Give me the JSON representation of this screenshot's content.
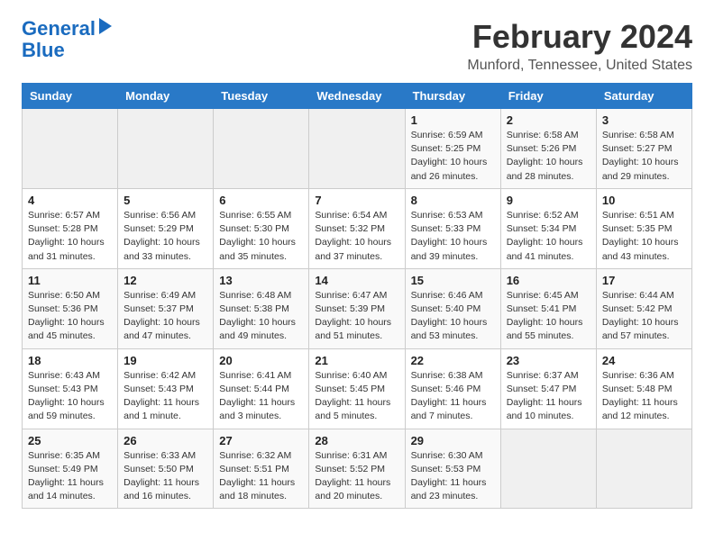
{
  "header": {
    "logo_line1": "General",
    "logo_line2": "Blue",
    "title": "February 2024",
    "subtitle": "Munford, Tennessee, United States"
  },
  "weekdays": [
    "Sunday",
    "Monday",
    "Tuesday",
    "Wednesday",
    "Thursday",
    "Friday",
    "Saturday"
  ],
  "weeks": [
    [
      {
        "day": "",
        "info": ""
      },
      {
        "day": "",
        "info": ""
      },
      {
        "day": "",
        "info": ""
      },
      {
        "day": "",
        "info": ""
      },
      {
        "day": "1",
        "info": "Sunrise: 6:59 AM\nSunset: 5:25 PM\nDaylight: 10 hours\nand 26 minutes."
      },
      {
        "day": "2",
        "info": "Sunrise: 6:58 AM\nSunset: 5:26 PM\nDaylight: 10 hours\nand 28 minutes."
      },
      {
        "day": "3",
        "info": "Sunrise: 6:58 AM\nSunset: 5:27 PM\nDaylight: 10 hours\nand 29 minutes."
      }
    ],
    [
      {
        "day": "4",
        "info": "Sunrise: 6:57 AM\nSunset: 5:28 PM\nDaylight: 10 hours\nand 31 minutes."
      },
      {
        "day": "5",
        "info": "Sunrise: 6:56 AM\nSunset: 5:29 PM\nDaylight: 10 hours\nand 33 minutes."
      },
      {
        "day": "6",
        "info": "Sunrise: 6:55 AM\nSunset: 5:30 PM\nDaylight: 10 hours\nand 35 minutes."
      },
      {
        "day": "7",
        "info": "Sunrise: 6:54 AM\nSunset: 5:32 PM\nDaylight: 10 hours\nand 37 minutes."
      },
      {
        "day": "8",
        "info": "Sunrise: 6:53 AM\nSunset: 5:33 PM\nDaylight: 10 hours\nand 39 minutes."
      },
      {
        "day": "9",
        "info": "Sunrise: 6:52 AM\nSunset: 5:34 PM\nDaylight: 10 hours\nand 41 minutes."
      },
      {
        "day": "10",
        "info": "Sunrise: 6:51 AM\nSunset: 5:35 PM\nDaylight: 10 hours\nand 43 minutes."
      }
    ],
    [
      {
        "day": "11",
        "info": "Sunrise: 6:50 AM\nSunset: 5:36 PM\nDaylight: 10 hours\nand 45 minutes."
      },
      {
        "day": "12",
        "info": "Sunrise: 6:49 AM\nSunset: 5:37 PM\nDaylight: 10 hours\nand 47 minutes."
      },
      {
        "day": "13",
        "info": "Sunrise: 6:48 AM\nSunset: 5:38 PM\nDaylight: 10 hours\nand 49 minutes."
      },
      {
        "day": "14",
        "info": "Sunrise: 6:47 AM\nSunset: 5:39 PM\nDaylight: 10 hours\nand 51 minutes."
      },
      {
        "day": "15",
        "info": "Sunrise: 6:46 AM\nSunset: 5:40 PM\nDaylight: 10 hours\nand 53 minutes."
      },
      {
        "day": "16",
        "info": "Sunrise: 6:45 AM\nSunset: 5:41 PM\nDaylight: 10 hours\nand 55 minutes."
      },
      {
        "day": "17",
        "info": "Sunrise: 6:44 AM\nSunset: 5:42 PM\nDaylight: 10 hours\nand 57 minutes."
      }
    ],
    [
      {
        "day": "18",
        "info": "Sunrise: 6:43 AM\nSunset: 5:43 PM\nDaylight: 10 hours\nand 59 minutes."
      },
      {
        "day": "19",
        "info": "Sunrise: 6:42 AM\nSunset: 5:43 PM\nDaylight: 11 hours\nand 1 minute."
      },
      {
        "day": "20",
        "info": "Sunrise: 6:41 AM\nSunset: 5:44 PM\nDaylight: 11 hours\nand 3 minutes."
      },
      {
        "day": "21",
        "info": "Sunrise: 6:40 AM\nSunset: 5:45 PM\nDaylight: 11 hours\nand 5 minutes."
      },
      {
        "day": "22",
        "info": "Sunrise: 6:38 AM\nSunset: 5:46 PM\nDaylight: 11 hours\nand 7 minutes."
      },
      {
        "day": "23",
        "info": "Sunrise: 6:37 AM\nSunset: 5:47 PM\nDaylight: 11 hours\nand 10 minutes."
      },
      {
        "day": "24",
        "info": "Sunrise: 6:36 AM\nSunset: 5:48 PM\nDaylight: 11 hours\nand 12 minutes."
      }
    ],
    [
      {
        "day": "25",
        "info": "Sunrise: 6:35 AM\nSunset: 5:49 PM\nDaylight: 11 hours\nand 14 minutes."
      },
      {
        "day": "26",
        "info": "Sunrise: 6:33 AM\nSunset: 5:50 PM\nDaylight: 11 hours\nand 16 minutes."
      },
      {
        "day": "27",
        "info": "Sunrise: 6:32 AM\nSunset: 5:51 PM\nDaylight: 11 hours\nand 18 minutes."
      },
      {
        "day": "28",
        "info": "Sunrise: 6:31 AM\nSunset: 5:52 PM\nDaylight: 11 hours\nand 20 minutes."
      },
      {
        "day": "29",
        "info": "Sunrise: 6:30 AM\nSunset: 5:53 PM\nDaylight: 11 hours\nand 23 minutes."
      },
      {
        "day": "",
        "info": ""
      },
      {
        "day": "",
        "info": ""
      }
    ]
  ]
}
